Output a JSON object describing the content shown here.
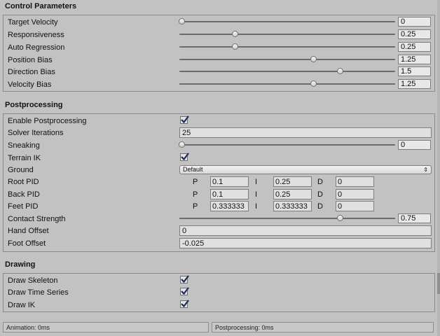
{
  "control": {
    "header": "Control Parameters",
    "rows": [
      {
        "label": "Target Velocity",
        "value": "0"
      },
      {
        "label": "Responsiveness",
        "value": "0.25"
      },
      {
        "label": "Auto Regression",
        "value": "0.25"
      },
      {
        "label": "Position Bias",
        "value": "1.25"
      },
      {
        "label": "Direction Bias",
        "value": "1.5"
      },
      {
        "label": "Velocity Bias",
        "value": "1.25"
      }
    ]
  },
  "post": {
    "header": "Postprocessing",
    "enable_label": "Enable Postprocessing",
    "solver_label": "Solver Iterations",
    "solver_value": "25",
    "sneaking_label": "Sneaking",
    "sneaking_value": "0",
    "terrain_label": "Terrain IK",
    "ground_label": "Ground",
    "ground_value": "Default",
    "pid_letters": {
      "p": "P",
      "i": "I",
      "d": "D"
    },
    "pids": [
      {
        "label": "Root PID",
        "p": "0.1",
        "i": "0.25",
        "d": "0"
      },
      {
        "label": "Back PID",
        "p": "0.1",
        "i": "0.25",
        "d": "0"
      },
      {
        "label": "Feet PID",
        "p": "0.333333",
        "i": "0.333333",
        "d": "0"
      }
    ],
    "contact_label": "Contact Strength",
    "contact_value": "0.75",
    "hand_label": "Hand Offset",
    "hand_value": "0",
    "foot_label": "Foot Offset",
    "foot_value": "-0.025"
  },
  "drawing": {
    "header": "Drawing",
    "skeleton_label": "Draw Skeleton",
    "timeseries_label": "Draw Time Series",
    "ik_label": "Draw IK"
  },
  "status": {
    "animation": "Animation: 0ms",
    "postprocessing": "Postprocessing: 0ms"
  },
  "icons": {
    "checkbox": "checkmark-icon",
    "dropdown": "chevron-up-down-icon"
  },
  "colors": {
    "panel_bg": "#c2c2c2",
    "field_bg": "#e0e0e0",
    "border": "#8a8a8a"
  }
}
